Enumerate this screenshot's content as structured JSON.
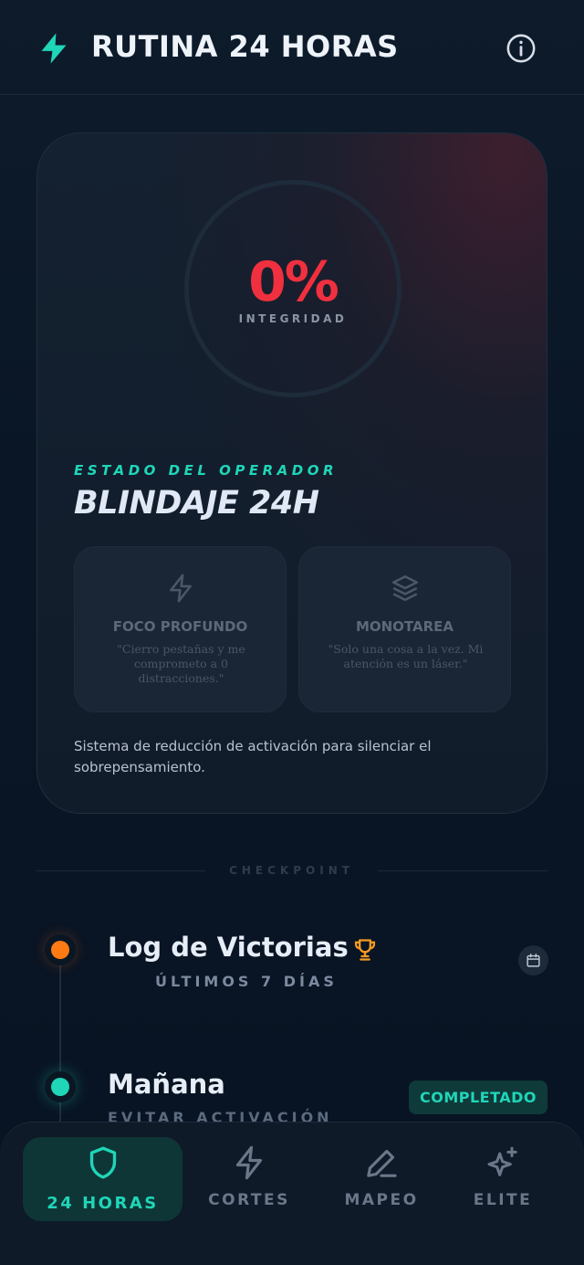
{
  "header": {
    "title": "RUTINA 24 HORAS"
  },
  "status": {
    "percent": "0%",
    "percent_label": "INTEGRIDAD",
    "state_label": "ESTADO DEL OPERADOR",
    "state_title": "BLINDAJE 24H"
  },
  "modes": [
    {
      "title": "FOCO PROFUNDO",
      "quote": "\"Cierro pestañas y me comprometo a 0 distracciones.\"",
      "icon": "bolt-icon"
    },
    {
      "title": "MONOTAREA",
      "quote": "\"Solo una cosa a la vez. Mi atención es un láser.\"",
      "icon": "layers-icon"
    }
  ],
  "description": "Sistema de reducción de activación para silenciar el sobrepensamiento.",
  "checkpoint": "CHECKPOINT",
  "timeline": [
    {
      "title": "Log de Victorias",
      "subtitle": "ÚLTIMOS 7 DÍAS",
      "icon": "trophy-icon",
      "action_icon": "calendar-icon"
    },
    {
      "title": "Mañana",
      "subtitle": "EVITAR ACTIVACIÓN",
      "badge": "COMPLETADO"
    }
  ],
  "nav": [
    {
      "label": "24 HORAS",
      "icon": "shield-icon",
      "active": true
    },
    {
      "label": "CORTES",
      "icon": "bolt-icon"
    },
    {
      "label": "MAPEO",
      "icon": "pen-icon"
    },
    {
      "label": "ELITE",
      "icon": "sparkles-icon"
    }
  ],
  "colors": {
    "accent": "#1fd6b8",
    "danger": "#f0303f",
    "warning": "#ff7a12"
  }
}
